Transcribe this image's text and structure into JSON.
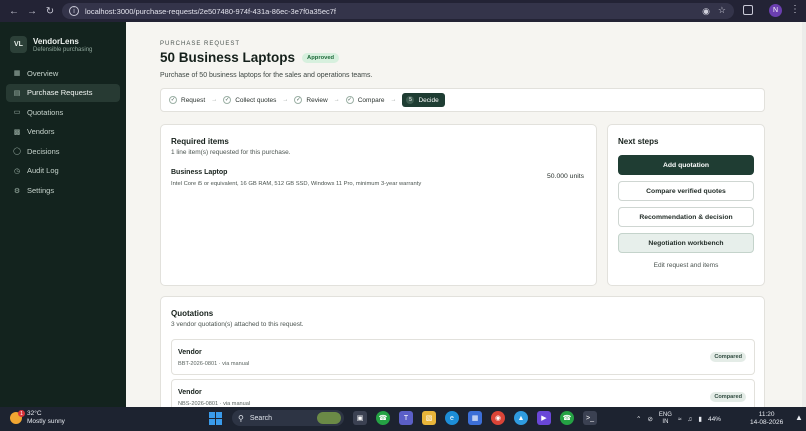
{
  "browser": {
    "url": "localhost:3000/purchase-requests/2e507480-974f-431a-86ec-3e7f0a35ec7f",
    "profile_initial": "N"
  },
  "app": {
    "logo": "VL",
    "name": "VendorLens",
    "tagline": "Defensible purchasing"
  },
  "sidebar": {
    "items": [
      {
        "label": "Overview",
        "icon": "grid-icon"
      },
      {
        "label": "Purchase Requests",
        "icon": "document-icon",
        "active": true
      },
      {
        "label": "Quotations",
        "icon": "quote-icon"
      },
      {
        "label": "Vendors",
        "icon": "building-icon"
      },
      {
        "label": "Decisions",
        "icon": "check-circle-icon"
      },
      {
        "label": "Audit Log",
        "icon": "clock-icon"
      },
      {
        "label": "Settings",
        "icon": "gear-icon"
      }
    ]
  },
  "page": {
    "eyebrow": "PURCHASE REQUEST",
    "title": "50 Business Laptops",
    "status": "Approved",
    "subtitle": "Purchase of 50 business laptops for the sales and operations teams."
  },
  "stepper": {
    "steps": [
      "Request",
      "Collect quotes",
      "Review",
      "Compare"
    ],
    "current": {
      "number": "5",
      "label": "Decide"
    }
  },
  "required_items": {
    "title": "Required items",
    "subtitle": "1 line item(s) requested for this purchase.",
    "items": [
      {
        "name": "Business Laptop",
        "description": "Intel Core i5 or equivalent, 16 GB RAM, 512 GB SSD, Windows 11 Pro, minimum 3-year warranty",
        "quantity": "50.000 units"
      }
    ]
  },
  "next_steps": {
    "title": "Next steps",
    "add_quotation": "Add quotation",
    "compare": "Compare verified quotes",
    "recommendation": "Recommendation & decision",
    "negotiation": "Negotiation workbench",
    "edit": "Edit request and items"
  },
  "quotations": {
    "title": "Quotations",
    "subtitle": "3 vendor quotation(s) attached to this request.",
    "rows": [
      {
        "vendor": "Vendor",
        "meta": "BBT-2026-0801 · via manual",
        "status": "Compared"
      },
      {
        "vendor": "Vendor",
        "meta": "NBS-2026-0801 · via manual",
        "status": "Compared"
      }
    ]
  },
  "taskbar": {
    "temp": "32°C",
    "weather": "Mostly sunny",
    "weather_badge": "1",
    "search": "Search",
    "lang_top": "ENG",
    "lang_bottom": "IN",
    "battery": "44%",
    "time": "11:20",
    "date": "14-08-2026"
  }
}
